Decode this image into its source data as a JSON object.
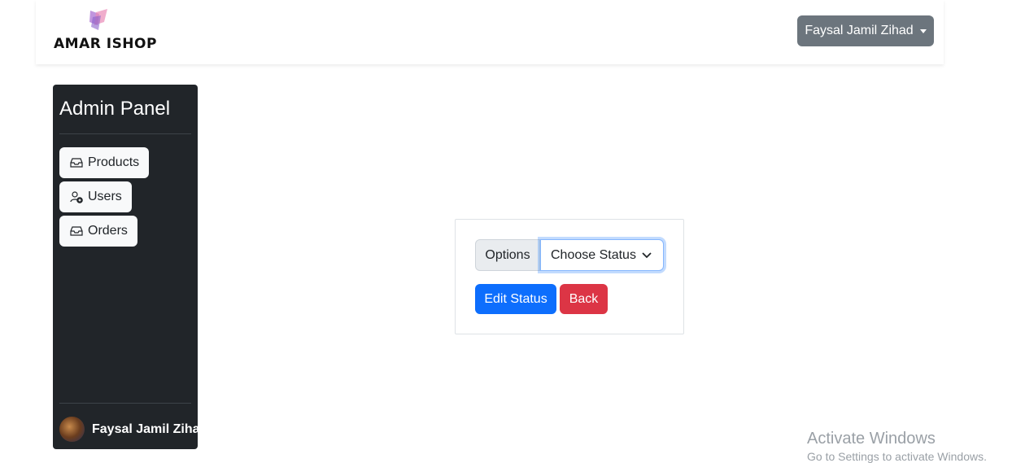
{
  "brand": {
    "name": "AMAR ISHOP",
    "logo_icon": "brand-logo-icon"
  },
  "header": {
    "user_name": "Faysal Jamil Zihad"
  },
  "sidebar": {
    "title": "Admin Panel",
    "items": [
      {
        "label": "Products",
        "icon": "inbox-icon"
      },
      {
        "label": "Users",
        "icon": "user-plus-icon"
      },
      {
        "label": "Orders",
        "icon": "inbox-icon"
      }
    ],
    "profile_name": "Faysal Jamil Zihad"
  },
  "form": {
    "options_label": "Options",
    "status_select_value": "Choose Status",
    "edit_button": "Edit Status",
    "back_button": "Back"
  },
  "watermark": {
    "title": "Activate Windows",
    "subtitle": "Go to Settings to activate Windows."
  },
  "colors": {
    "primary": "#0d6efd",
    "danger": "#dc3545",
    "secondary": "#6c757d",
    "sidebar_bg": "#212529"
  }
}
